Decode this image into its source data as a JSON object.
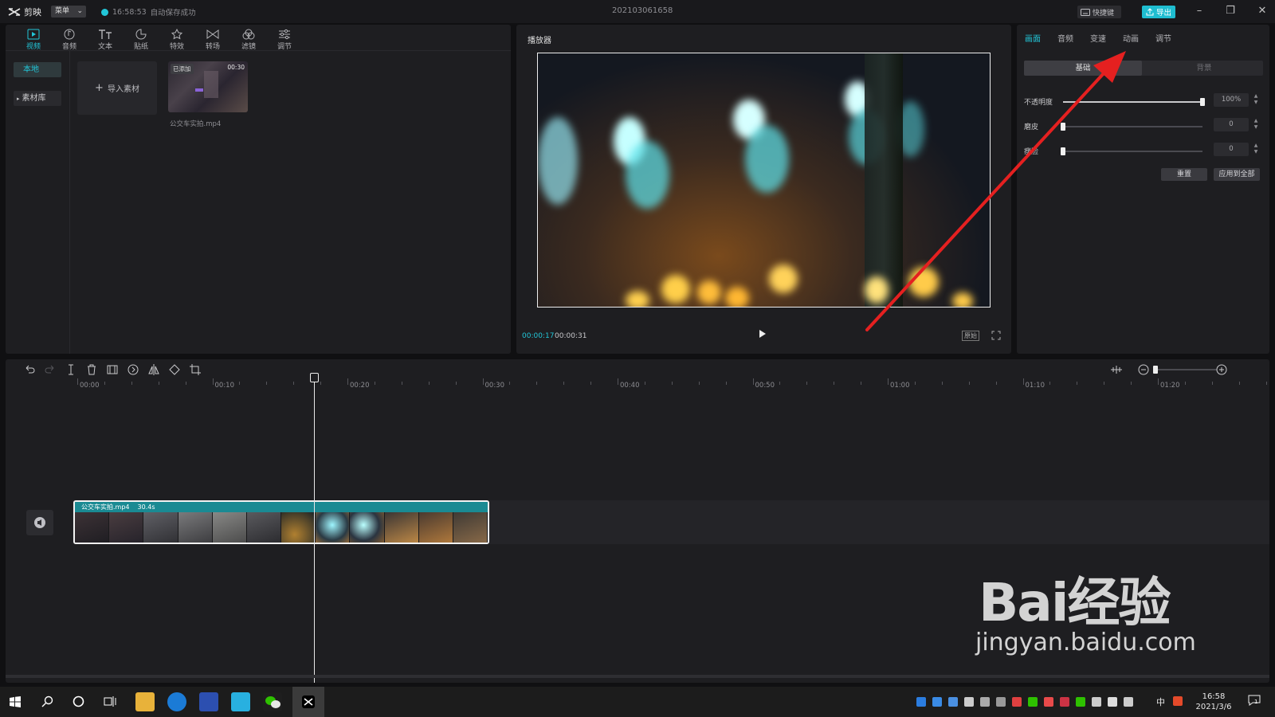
{
  "titlebar": {
    "app_name": "剪映",
    "menu_label": "菜单",
    "save_time": "16:58:53",
    "save_status": "自动保存成功",
    "project_name": "202103061658",
    "shortcut_label": "快捷键",
    "export_label": "导出"
  },
  "media_toolbar": {
    "tabs": [
      {
        "label": "视频",
        "icon": "video-icon",
        "active": true
      },
      {
        "label": "音频",
        "icon": "audio-icon"
      },
      {
        "label": "文本",
        "icon": "text-icon"
      },
      {
        "label": "贴纸",
        "icon": "sticker-icon"
      },
      {
        "label": "特效",
        "icon": "effects-icon"
      },
      {
        "label": "转场",
        "icon": "transition-icon"
      },
      {
        "label": "滤镜",
        "icon": "filter-icon"
      },
      {
        "label": "调节",
        "icon": "adjust-icon"
      }
    ]
  },
  "media": {
    "sidebar": {
      "local": "本地",
      "library": "素材库"
    },
    "import_label": "导入素材",
    "items": [
      {
        "badge": "已添加",
        "duration": "00:30",
        "name": "公交车实拍.mp4"
      }
    ]
  },
  "player": {
    "title": "播放器",
    "current_time": "00:00:17",
    "total_time": "00:00:31",
    "ratio_label": "原始"
  },
  "properties": {
    "tabs": [
      {
        "label": "画面",
        "active": true
      },
      {
        "label": "音频"
      },
      {
        "label": "变速"
      },
      {
        "label": "动画"
      },
      {
        "label": "调节"
      }
    ],
    "segments": {
      "basic": "基础",
      "background": "背景"
    },
    "rows": [
      {
        "label": "不透明度",
        "value": "100%",
        "level": 1.0
      },
      {
        "label": "磨皮",
        "value": "0",
        "level": 0
      },
      {
        "label": "瘦脸",
        "value": "0",
        "level": 0
      }
    ],
    "reset_label": "重置",
    "apply_all_label": "应用到全部"
  },
  "timeline": {
    "ruler": [
      "00:00",
      "00:10",
      "00:20",
      "00:30",
      "00:40",
      "00:50",
      "01:00",
      "01:10",
      "01:20"
    ],
    "clip": {
      "name": "公交车实拍.mp4",
      "duration": "30.4s"
    }
  },
  "taskbar": {
    "time": "16:58",
    "date": "2021/3/6",
    "ime": "中",
    "notification_count": "1"
  },
  "watermark": {
    "main": "Bai经验",
    "sub": "jingyan.baidu.com"
  },
  "colors": {
    "accent": "#22c6d8",
    "annotation_arrow": "#e52020",
    "clip_header": "#1a8a93"
  }
}
